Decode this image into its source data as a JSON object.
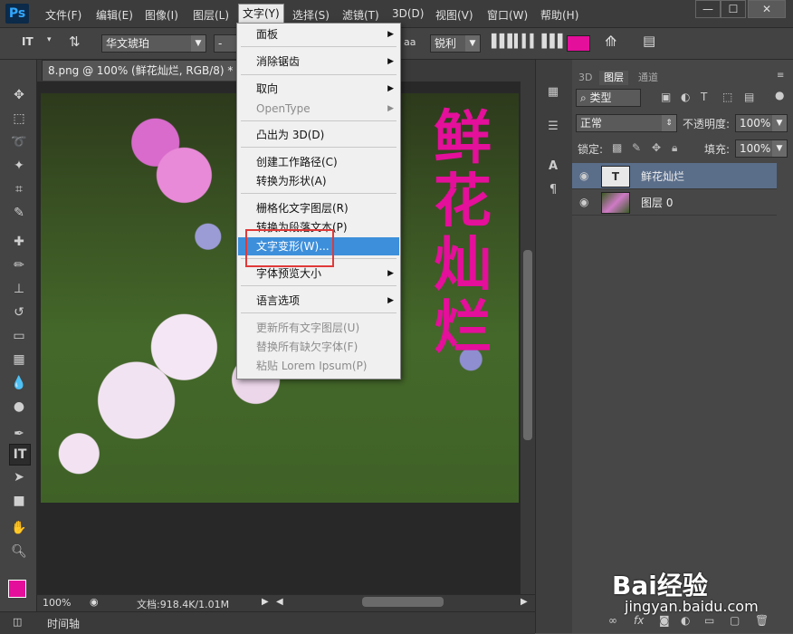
{
  "app": {
    "logo": "Ps"
  },
  "menubar": {
    "items": [
      "文件(F)",
      "编辑(E)",
      "图像(I)",
      "图层(L)",
      "文字(Y)",
      "选择(S)",
      "滤镜(T)",
      "3D(D)",
      "视图(V)",
      "窗口(W)",
      "帮助(H)"
    ],
    "window_buttons": [
      "—",
      "☐",
      "✕"
    ]
  },
  "options": {
    "tool_glyph": "IT",
    "font_family": "华文琥珀",
    "font_style": "-",
    "aa_icon": "aa",
    "antialias": "锐利",
    "color_swatch": "#e40f9a"
  },
  "document": {
    "tab_title": "8.png @ 100% (鲜花灿烂, RGB/8) *",
    "close": "×",
    "vertical_text": [
      "鲜",
      "花",
      "灿",
      "烂"
    ],
    "zoom": "100%",
    "doc_info": "文档:918.4K/1.01M",
    "timeline_label": "时间轴"
  },
  "panels": {
    "tabs": [
      "3D",
      "图层",
      "通道"
    ],
    "filter_kind": "类型",
    "blend_mode": "正常",
    "opacity_label": "不透明度:",
    "opacity_value": "100%",
    "lock_label": "锁定:",
    "fill_label": "填充:",
    "fill_value": "100%",
    "layers": [
      {
        "name": "鲜花灿烂",
        "kind": "text",
        "thumb_glyph": "T"
      },
      {
        "name": "图层 0",
        "kind": "image"
      }
    ]
  },
  "menu": {
    "items": [
      {
        "label": "面板",
        "submenu": true,
        "disabled": false
      },
      {
        "label": "消除锯齿",
        "submenu": true,
        "disabled": false
      },
      {
        "label": "取向",
        "submenu": true,
        "disabled": false
      },
      {
        "label": "OpenType",
        "submenu": true,
        "disabled": true
      },
      {
        "label": "凸出为 3D(D)",
        "submenu": false,
        "disabled": false
      },
      {
        "label": "创建工作路径(C)",
        "submenu": false,
        "disabled": false
      },
      {
        "label": "转换为形状(A)",
        "submenu": false,
        "disabled": false
      },
      {
        "label": "栅格化文字图层(R)",
        "submenu": false,
        "disabled": false
      },
      {
        "label": "转换为段落文本(P)",
        "submenu": false,
        "disabled": false
      },
      {
        "label": "文字变形(W)...",
        "submenu": false,
        "disabled": false,
        "highlighted": true
      },
      {
        "label": "字体预览大小",
        "submenu": true,
        "disabled": false
      },
      {
        "label": "语言选项",
        "submenu": true,
        "disabled": false
      },
      {
        "label": "更新所有文字图层(U)",
        "submenu": false,
        "disabled": true
      },
      {
        "label": "替换所有缺欠字体(F)",
        "submenu": false,
        "disabled": true
      },
      {
        "label": "粘贴 Lorem Ipsum(P)",
        "submenu": false,
        "disabled": true
      }
    ]
  },
  "watermark": {
    "brand": "Bai经验",
    "url": "jingyan.baidu.com"
  }
}
